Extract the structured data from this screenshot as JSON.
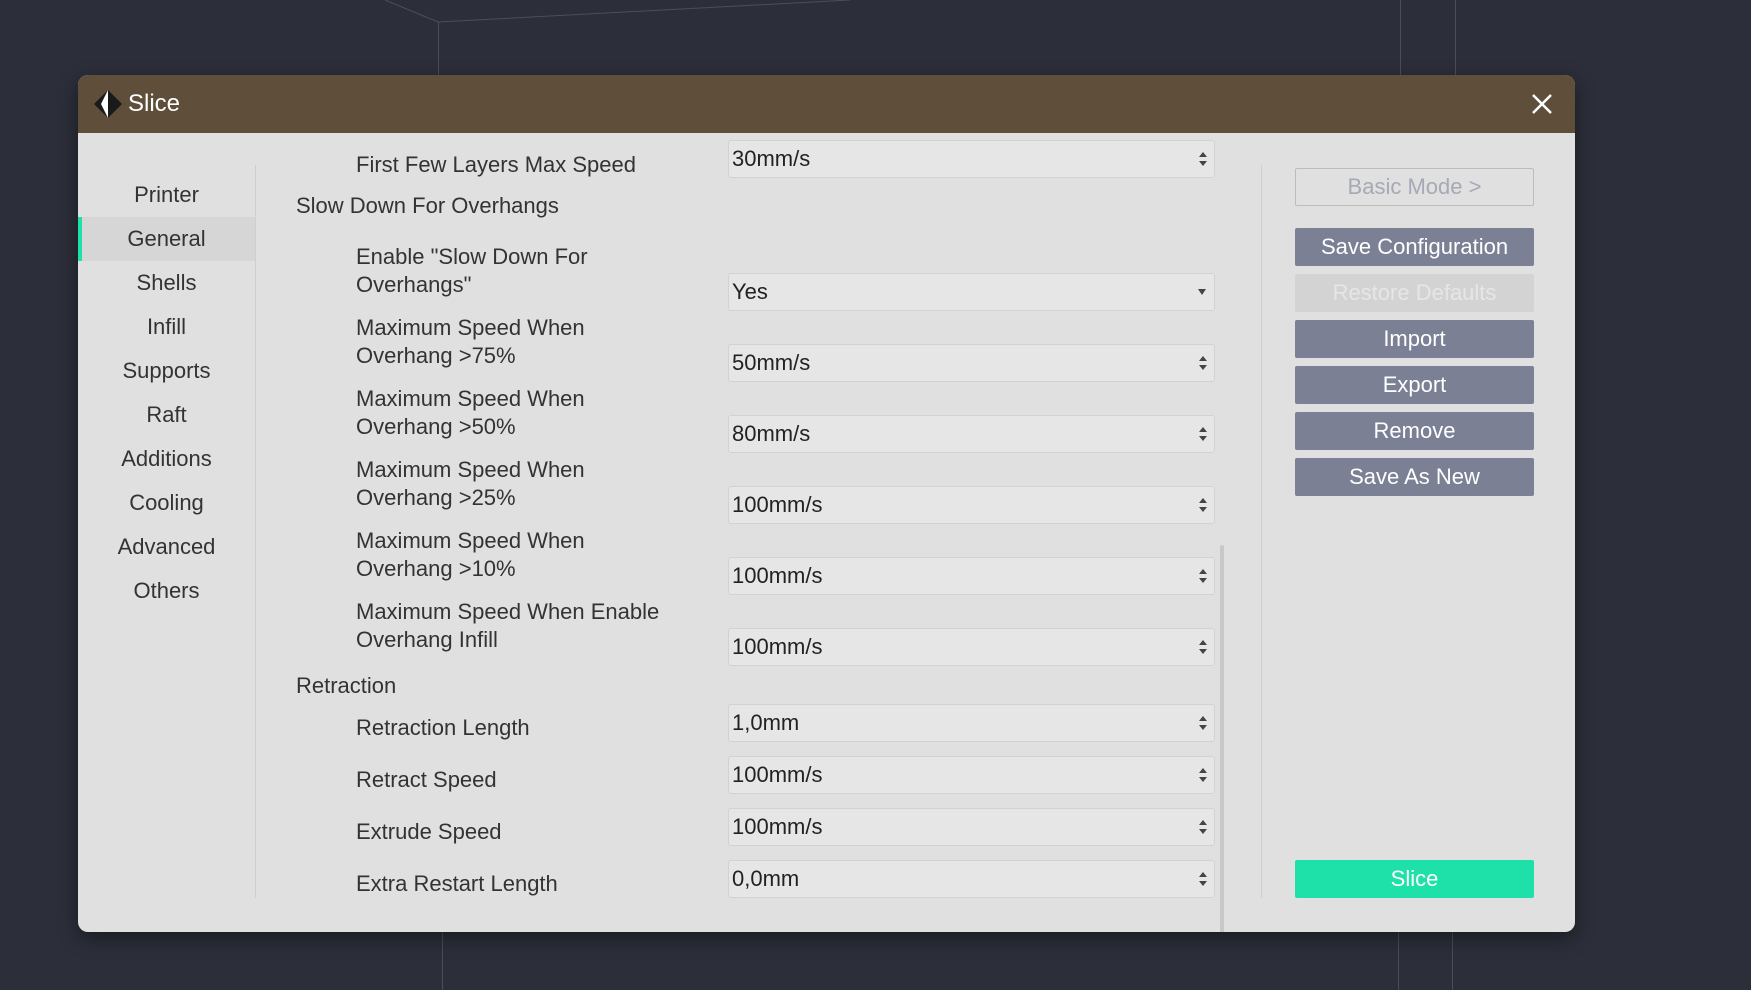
{
  "dialog": {
    "title": "Slice"
  },
  "sidebar": {
    "items": [
      {
        "label": "Printer"
      },
      {
        "label": "General"
      },
      {
        "label": "Shells"
      },
      {
        "label": "Infill"
      },
      {
        "label": "Supports"
      },
      {
        "label": "Raft"
      },
      {
        "label": "Additions"
      },
      {
        "label": "Cooling"
      },
      {
        "label": "Advanced"
      },
      {
        "label": "Others"
      }
    ],
    "active": "General"
  },
  "settings": {
    "first_layers": {
      "label": "First Few Layers Max Speed",
      "value": "30mm/s"
    },
    "overhangs_section": "Slow Down For Overhangs",
    "enable_overhangs": {
      "label": "Enable \"Slow Down For Overhangs\"",
      "value": "Yes"
    },
    "speed_75": {
      "label": "Maximum Speed When Overhang >75%",
      "value": "50mm/s"
    },
    "speed_50": {
      "label": "Maximum Speed When Overhang >50%",
      "value": "80mm/s"
    },
    "speed_25": {
      "label": "Maximum Speed When Overhang >25%",
      "value": "100mm/s"
    },
    "speed_10": {
      "label": "Maximum Speed When Overhang >10%",
      "value": "100mm/s"
    },
    "speed_infill": {
      "label": "Maximum Speed When Enable Overhang Infill",
      "value": "100mm/s"
    },
    "retraction_section": "Retraction",
    "retraction_length": {
      "label": "Retraction Length",
      "value": "1,0mm"
    },
    "retract_speed": {
      "label": "Retract Speed",
      "value": "100mm/s"
    },
    "extrude_speed": {
      "label": "Extrude Speed",
      "value": "100mm/s"
    },
    "extra_restart": {
      "label": "Extra Restart Length",
      "value": "0,0mm"
    }
  },
  "actions": {
    "basic_mode": "Basic Mode >",
    "save_configuration": "Save Configuration",
    "restore_defaults": "Restore Defaults",
    "import": "Import",
    "export": "Export",
    "remove": "Remove",
    "save_as_new": "Save As New",
    "slice": "Slice"
  },
  "colors": {
    "titlebar": "#5e4e3a",
    "accent": "#1de1a8",
    "button": "#7b8094",
    "background": "#2c2f3a"
  },
  "icons": {
    "logo": "app-logo-icon",
    "close": "close-icon",
    "spinner": "spinner-arrows-icon",
    "dropdown": "dropdown-arrow-icon"
  }
}
